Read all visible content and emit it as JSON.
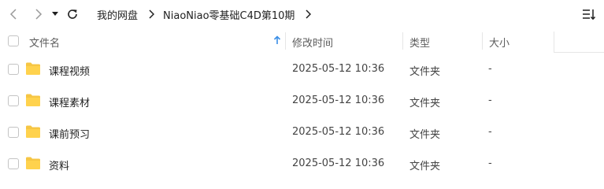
{
  "toolbar": {
    "back_icon": "chevron-left-icon",
    "forward_icon": "chevron-right-icon",
    "history_icon": "caret-down-icon",
    "refresh_icon": "refresh-icon",
    "view_icon": "sort-list-icon"
  },
  "breadcrumb": {
    "items": [
      "我的网盘",
      "NiaoNiao零基础C4D第10期"
    ]
  },
  "columns": {
    "name": "文件名",
    "modified": "修改时间",
    "type": "类型",
    "size": "大小",
    "sort_icon": "sort-ascending-arrow-icon",
    "accent_color": "#3a8ee6"
  },
  "rows": [
    {
      "name": "课程视频",
      "modified": "2025-05-12 10:36",
      "type": "文件夹",
      "size": "-"
    },
    {
      "name": "课程素材",
      "modified": "2025-05-12 10:36",
      "type": "文件夹",
      "size": "-"
    },
    {
      "name": "课前预习",
      "modified": "2025-05-12 10:36",
      "type": "文件夹",
      "size": "-"
    },
    {
      "name": "资料",
      "modified": "2025-05-12 10:36",
      "type": "文件夹",
      "size": "-"
    }
  ],
  "folder_color": "#f6c644"
}
